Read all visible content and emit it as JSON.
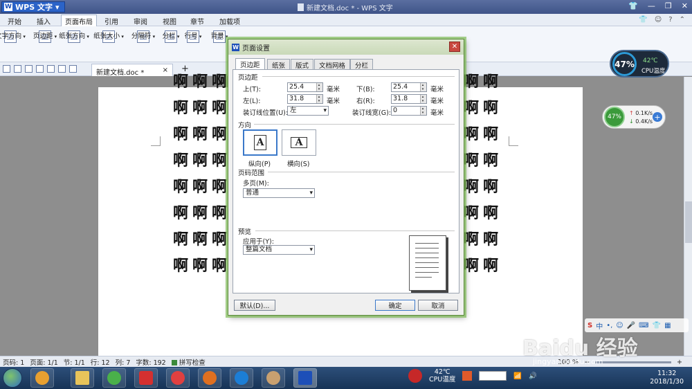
{
  "titlebar": {
    "app_name": "WPS 文字",
    "doc_title": "新建文档.doc * - WPS 文字"
  },
  "menu": {
    "tabs": [
      "开始",
      "插入",
      "页面布局",
      "引用",
      "审阅",
      "视图",
      "章节",
      "加载项"
    ],
    "active": 2
  },
  "ribbon": {
    "buttons": [
      "文字方向",
      "页边距",
      "纸张方向",
      "纸张大小",
      "分隔符",
      "分栏",
      "行号",
      "背景"
    ]
  },
  "doc_tab": {
    "label": "新建文档.doc *"
  },
  "document": {
    "char": "啊"
  },
  "statusbar": {
    "page": "页码: 1",
    "pages": "页面: 1/1",
    "section": "节: 1/1",
    "line": "行: 12",
    "column": "列: 7",
    "words": "字数: 192",
    "spell": "拼写检查",
    "zoom": "100 %"
  },
  "dialog": {
    "title": "页面设置",
    "tabs": [
      "页边距",
      "纸张",
      "版式",
      "文档网格",
      "分栏"
    ],
    "sections": {
      "margins": "页边距",
      "orientation": "方向",
      "page_range": "页码范围",
      "preview": "预览"
    },
    "margins": {
      "top_label": "上(T):",
      "top_value": "25.4",
      "bottom_label": "下(B):",
      "bottom_value": "25.4",
      "left_label": "左(L):",
      "left_value": "31.8",
      "right_label": "右(R):",
      "right_value": "31.8",
      "gutter_pos_label": "装订线位置(U):",
      "gutter_pos_value": "左",
      "gutter_label": "装订线宽(G):",
      "gutter_value": "0",
      "unit": "毫米"
    },
    "orientation": {
      "portrait": "纵向(P)",
      "landscape": "横向(S)",
      "glyph": "A"
    },
    "page_range": {
      "label": "多页(M):",
      "value": "普通"
    },
    "preview": {
      "apply_label": "应用于(Y):",
      "apply_value": "整篇文档"
    },
    "buttons": {
      "default": "默认(D)...",
      "ok": "确定",
      "cancel": "取消"
    }
  },
  "cpu_widget": {
    "percent": "47%",
    "temp": "42℃",
    "label": "CPU温度"
  },
  "net_widget": {
    "percent": "47%",
    "up": "0.1K/s",
    "down": "0.4K/s"
  },
  "taskbar": {
    "cpu_temp": "42℃",
    "cpu_label": "CPU温度",
    "time": "11:32",
    "date": "2018/1/30"
  },
  "watermark": {
    "brand": "Baidu 经验",
    "url": "jingyan.baidu.com"
  },
  "colors": {
    "accent": "#3a78c9",
    "dialog_border": "#5a8a3a"
  }
}
